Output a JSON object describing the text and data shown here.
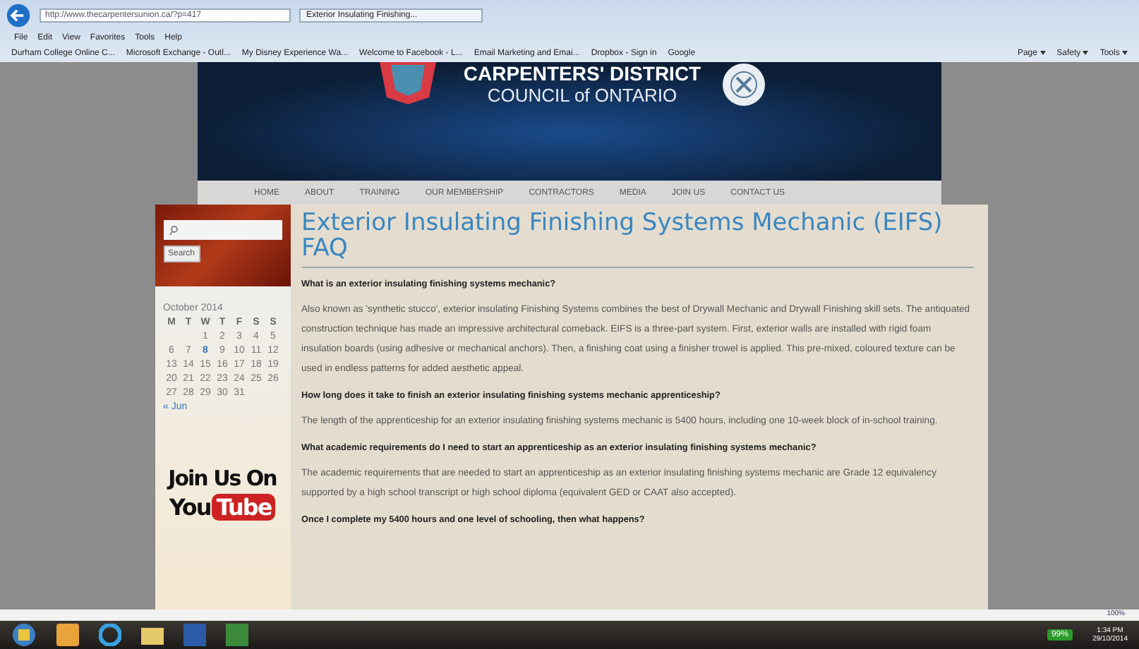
{
  "browser": {
    "url": "http://www.thecarpentersunion.ca/?p=417",
    "tab": "Exterior Insulating Finishing...",
    "menu": [
      "File",
      "Edit",
      "View",
      "Favorites",
      "Tools",
      "Help"
    ],
    "favorites": [
      "Durham College Online C...",
      "Microsoft Exchange - Outl...",
      "My Disney Experience Wa...",
      "Welcome to Facebook - L...",
      "Email Marketing and Emai...",
      "Dropbox - Sign in",
      "Google"
    ],
    "commands": [
      "Page",
      "Safety",
      "Tools"
    ]
  },
  "header": {
    "line1": "CARPENTERS' DISTRICT",
    "line2": "COUNCIL of ONTARIO"
  },
  "nav": [
    "HOME",
    "ABOUT",
    "TRAINING",
    "OUR MEMBERSHIP",
    "CONTRACTORS",
    "MEDIA",
    "JOIN US",
    "CONTACT US"
  ],
  "sidebar": {
    "search_button": "Search",
    "calendar": {
      "title": "October 2014",
      "weekdays": [
        "M",
        "T",
        "W",
        "T",
        "F",
        "S",
        "S"
      ],
      "weeks": [
        [
          {
            "day": "1",
            "linked": false
          },
          {
            "day": "2",
            "linked": false
          },
          {
            "day": "3",
            "linked": false
          },
          {
            "day": "4",
            "linked": false
          },
          {
            "day": "5",
            "linked": false
          }
        ],
        [
          {
            "day": "6",
            "linked": false
          },
          {
            "day": "7",
            "linked": false
          },
          {
            "day": "8",
            "linked": true
          },
          {
            "day": "9",
            "linked": false
          },
          {
            "day": "10",
            "linked": false
          },
          {
            "day": "11",
            "linked": false
          },
          {
            "day": "12",
            "linked": false
          }
        ],
        [
          {
            "day": "13",
            "linked": false
          },
          {
            "day": "14",
            "linked": false
          },
          {
            "day": "15",
            "linked": false
          },
          {
            "day": "16",
            "linked": false
          },
          {
            "day": "17",
            "linked": false
          },
          {
            "day": "18",
            "linked": false
          },
          {
            "day": "19",
            "linked": false
          }
        ],
        [
          {
            "day": "20",
            "linked": false
          },
          {
            "day": "21",
            "linked": false
          },
          {
            "day": "22",
            "linked": false
          },
          {
            "day": "23",
            "linked": false
          },
          {
            "day": "24",
            "linked": false
          },
          {
            "day": "25",
            "linked": false
          },
          {
            "day": "26",
            "linked": false
          }
        ],
        [
          {
            "day": "27",
            "linked": false
          },
          {
            "day": "28",
            "linked": false
          },
          {
            "day": "29",
            "linked": false
          },
          {
            "day": "30",
            "linked": false
          },
          {
            "day": "31",
            "linked": false
          }
        ]
      ],
      "prev": "« Jun"
    },
    "promo_line1": "Join Us On",
    "promo_you": "You",
    "promo_tube": "Tube"
  },
  "article": {
    "title": "Exterior Insulating Finishing Systems Mechanic (EIFS) FAQ",
    "blocks": [
      {
        "kind": "question",
        "text": "What is an exterior insulating finishing systems mechanic?"
      },
      {
        "kind": "answer",
        "text": "Also known as 'synthetic stucco', exterior insulating Finishing Systems combines the best of Drywall Mechanic and Drywall Finishing skill sets. The antiquated construction technique has made an impressive architectural comeback. EIFS is a three-part system. First, exterior walls are installed with rigid foam insulation boards (using adhesive or mechanical anchors). Then, a finishing coat using a finisher trowel is applied. This pre-mixed, coloured texture can be used in endless patterns for added aesthetic appeal."
      },
      {
        "kind": "question",
        "text": "How long does it take to finish an exterior insulating finishing systems mechanic apprenticeship?"
      },
      {
        "kind": "answer",
        "text": "The length of the apprenticeship for an exterior insulating finishing systems mechanic is 5400 hours, including one 10-week block of in-school training."
      },
      {
        "kind": "question",
        "text": "What academic requirements do I need to start an apprenticeship as an exterior insulating finishing systems mechanic?"
      },
      {
        "kind": "answer",
        "text": "The academic requirements that are needed to start an apprenticeship as an exterior insulating finishing systems mechanic are Grade 12 equivalency supported by a high school transcript or high school diploma (equivalent GED or CAAT also accepted)."
      },
      {
        "kind": "question",
        "text": "Once I complete my 5400 hours and one level of schooling, then what happens?"
      }
    ]
  },
  "status_bar": {
    "zoom": "100%"
  },
  "taskbar": {
    "battery": "99%",
    "time": "1:34 PM",
    "date": "29/10/2014"
  }
}
